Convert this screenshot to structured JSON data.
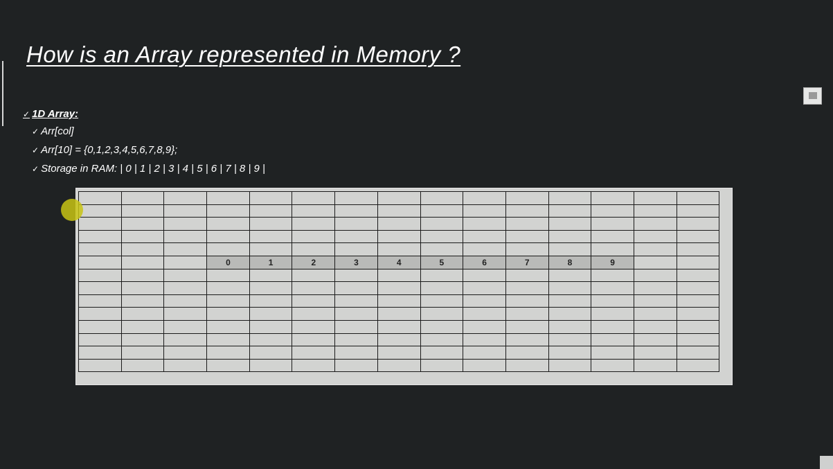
{
  "slide": {
    "title": "How is an Array represented in Memory ?",
    "heading": "1D Array:",
    "check_glyph": "✓",
    "bullets": [
      "Arr[col]",
      "Arr[10] = {0,1,2,3,4,5,6,7,8,9};",
      "Storage in RAM: | 0 | 1 | 2 | 3 | 4 | 5 | 6 | 7 | 8 | 9 |"
    ]
  },
  "memory_grid": {
    "rows": 14,
    "cols": 15,
    "highlight_row": 5,
    "highlight_start_col": 3,
    "values": [
      "0",
      "1",
      "2",
      "3",
      "4",
      "5",
      "6",
      "7",
      "8",
      "9"
    ]
  },
  "icons": [
    "slide-thumbnail-icon",
    "navigation-corner-icon"
  ]
}
